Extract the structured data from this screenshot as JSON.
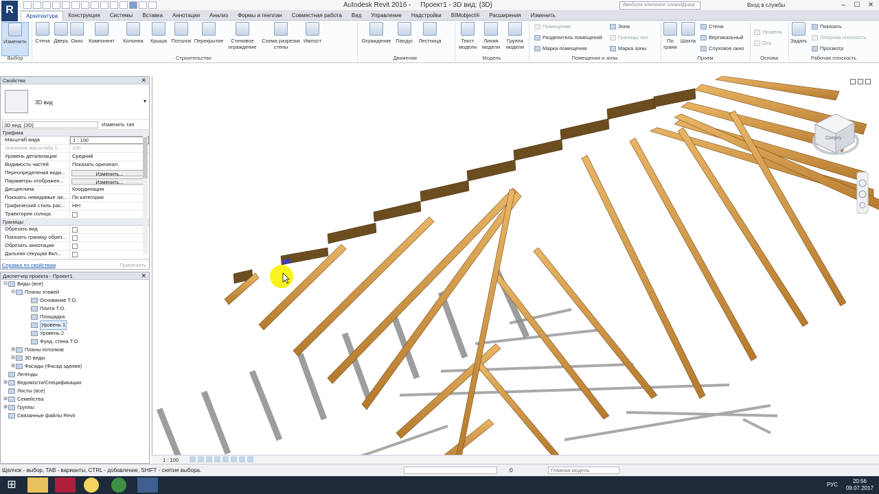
{
  "window": {
    "title": "Autodesk Revit 2016 -     Проект1 - 3D вид: {3D}",
    "search_placeholder": "Введите ключевое слово/фразу",
    "login": "Вход в службы"
  },
  "tabs": [
    "Архитектура",
    "Конструкция",
    "Системы",
    "Вставка",
    "Аннотации",
    "Анализ",
    "Формы и генплан",
    "Совместная работа",
    "Вид",
    "Управление",
    "Надстройки",
    "BIMobject®",
    "Расширения",
    "Изменить"
  ],
  "ribbon": {
    "modify": "Изменить",
    "select_group": "Выбор",
    "build": [
      "Стена",
      "Дверь",
      "Окно",
      "Компонент",
      "Колонна",
      "Крыша",
      "Потолок",
      "Перекрытие",
      "Стеновое ограждение",
      "Схема разрезки стены",
      "Импост"
    ],
    "build_group": "Строительство",
    "circ": [
      "Ограждение",
      "Пандус",
      "Лестница"
    ],
    "circ_group": "Движение",
    "model": [
      "Текст модели",
      "Линия модели",
      "Группа модели"
    ],
    "model_group": "Модель",
    "rooms": [
      "Помещение",
      "Разделитель помещений",
      "Марка помещения"
    ],
    "zones": [
      "Зона",
      "Границы зон",
      "Марка зоны"
    ],
    "rooms_group": "Помещения и зоны",
    "opening": [
      "По грани",
      "Шахта"
    ],
    "opening_small": [
      "Стена",
      "Вертикальный",
      "Слуховое окно"
    ],
    "opening_group": "Проем",
    "datum": [
      "Уровень",
      "Ось"
    ],
    "datum_group": "Основа",
    "wp_set": "Задать",
    "wp": [
      "Показать",
      "Опорная плоскость",
      "Просмотр"
    ],
    "wp_group": "Рабочая плоскость"
  },
  "properties": {
    "title": "Свойства",
    "type_name": "3D вид",
    "instance": "3D вид: {3D}",
    "edit_type": "Изменить тип",
    "cat_graphics": "Графика",
    "rows": [
      {
        "k": "Масштаб вида",
        "v": "1 : 100"
      },
      {
        "k": "Значение масштаба    1:",
        "v": "100"
      },
      {
        "k": "Уровень детализации",
        "v": "Средний"
      },
      {
        "k": "Видимость частей",
        "v": "Показать оригинал"
      },
      {
        "k": "Переопределения види...",
        "v": "Изменить..."
      },
      {
        "k": "Параметры отображен...",
        "v": "Изменить..."
      },
      {
        "k": "Дисциплина",
        "v": "Координация"
      },
      {
        "k": "Показать невидимые ли...",
        "v": "По категории"
      },
      {
        "k": "Графический стиль рас...",
        "v": "Нет"
      },
      {
        "k": "Траектория солнца",
        "v": ""
      }
    ],
    "cat_bounds": "Границы",
    "rows2": [
      {
        "k": "Обрезать вид"
      },
      {
        "k": "Показать границу обрез..."
      },
      {
        "k": "Обрезать аннотации"
      },
      {
        "k": "Дальняя секущая Вкл..."
      }
    ],
    "help": "Справка по свойствам",
    "apply": "Применить"
  },
  "browser": {
    "title": "Диспетчер проекта - Проект1",
    "items": [
      {
        "label": "Виды (все)",
        "lvl": 0,
        "tg": "⊟"
      },
      {
        "label": "Планы этажей",
        "lvl": 1,
        "tg": "⊟"
      },
      {
        "label": "Основание Т.О.",
        "lvl": 3,
        "tg": ""
      },
      {
        "label": "Плита Т.О.",
        "lvl": 3,
        "tg": ""
      },
      {
        "label": "Площадка",
        "lvl": 3,
        "tg": ""
      },
      {
        "label": "Уровень 1",
        "lvl": 3,
        "tg": ""
      },
      {
        "label": "Уровень 2",
        "lvl": 3,
        "tg": ""
      },
      {
        "label": "Фунд. стена Т.О.",
        "lvl": 3,
        "tg": ""
      },
      {
        "label": "Планы потолков",
        "lvl": 1,
        "tg": "⊞"
      },
      {
        "label": "3D виды",
        "lvl": 1,
        "tg": "⊞"
      },
      {
        "label": "Фасады (Фасад здания)",
        "lvl": 1,
        "tg": "⊞"
      },
      {
        "label": "Легенды",
        "lvl": 0,
        "tg": ""
      },
      {
        "label": "Ведомости/Спецификации",
        "lvl": 0,
        "tg": "⊞"
      },
      {
        "label": "Листы (все)",
        "lvl": 0,
        "tg": ""
      },
      {
        "label": "Семейства",
        "lvl": 0,
        "tg": "⊞"
      },
      {
        "label": "Группы",
        "lvl": 0,
        "tg": "⊞"
      },
      {
        "label": "Связанные файлы Revit",
        "lvl": 0,
        "tg": ""
      }
    ]
  },
  "viewbar": {
    "scale": "1 : 100"
  },
  "status": {
    "message": "Щелчок - выбор, TAB - варианты, CTRL - добавление, SHIFT - снятие выбора.",
    "zero": ":0",
    "model": "Главная модель"
  },
  "taskbar": {
    "lang": "РУС",
    "time": "20:56",
    "date": "09.07.2017"
  },
  "viewcube": {
    "label": "Сверху"
  }
}
